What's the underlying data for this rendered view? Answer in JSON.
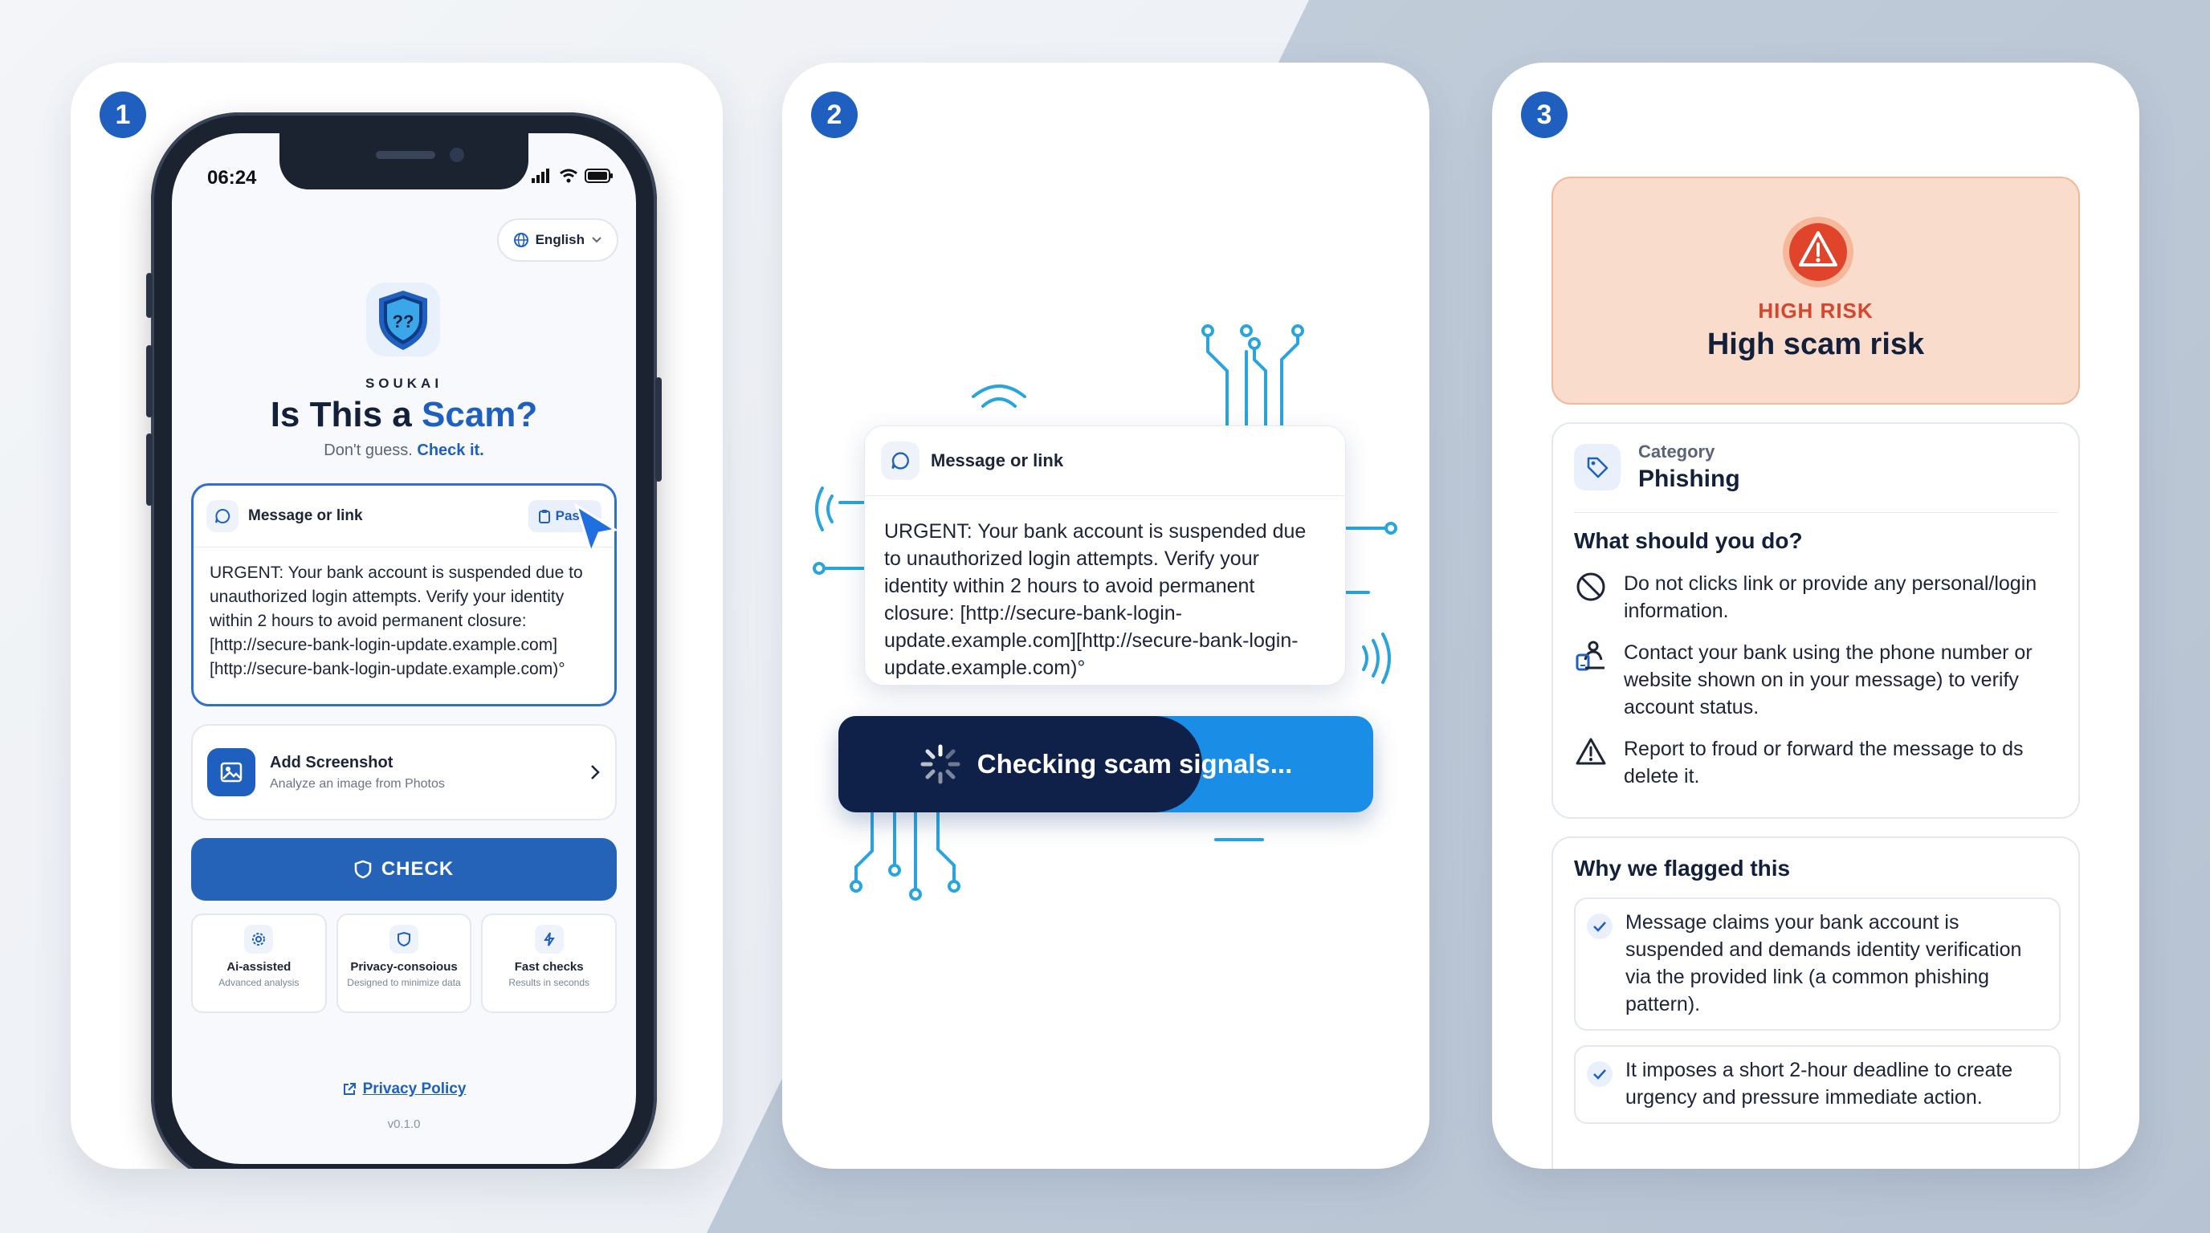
{
  "steps": [
    "1",
    "2",
    "3"
  ],
  "phone": {
    "status_time": "06:24",
    "language": "English",
    "brand": "SOUKAI",
    "title_prefix": "Is This a",
    "title_accent": "Scam?",
    "tagline_prefix": "Don't guess.",
    "tagline_accent": "Check it.",
    "message_label": "Message or link",
    "paste_label": "Paste",
    "message_text": "URGENT: Your bank account is suspended due to unauthorized login attempts. Verify your identity within 2 hours to avoid permanent closure: [http://secure-bank-login-update.example.com][http://secure-bank-login-update.example.com)°",
    "screenshot_title": "Add Screenshot",
    "screenshot_sub": "Analyze an image from Photos",
    "check_label": "CHECK",
    "features": [
      {
        "title": "Ai-assisted",
        "sub": "Advanced analysis",
        "icon": "gear-icon"
      },
      {
        "title": "Privacy-consoious",
        "sub": "Designed to minimize data",
        "icon": "shield-icon"
      },
      {
        "title": "Fast checks",
        "sub": "Results in seconds",
        "icon": "bolt-icon"
      }
    ],
    "privacy_link": "Privacy Policy",
    "version": "v0.1.0"
  },
  "analysis": {
    "message_label": "Message or link",
    "message_text": "URGENT: Your bank account is suspended due to unauthorized login attempts. Verify your identity within 2 hours to avoid permanent closure: [http://secure-bank-login-update.example.com][http://secure-bank-login-update.example.com)°",
    "progress_label": "Checking scam signals...",
    "progress_fraction": 0.68
  },
  "result": {
    "risk_level": "HIGH RISK",
    "risk_title": "High scam risk",
    "category_label": "Category",
    "category_value": "Phishing",
    "todo_title": "What should you do?",
    "todo_items": [
      {
        "icon": "block-icon",
        "text": "Do not clicks link or provide any personal/login information."
      },
      {
        "icon": "phone-support-icon",
        "text": "Contact your bank using the phone number or website shown on in your message) to verify account status."
      },
      {
        "icon": "warning-icon",
        "text": "Report to froud or forward the message to ds delete it."
      }
    ],
    "why_title": "Why we flagged this",
    "reasons": [
      "Message claims your bank account is suspended and demands identity verification via the provided link (a common phishing pattern).",
      "It imposes a short 2-hour deadline to create urgency and pressure immediate action."
    ]
  },
  "colors": {
    "primary": "#1f5fbf",
    "risk": "#d6452d",
    "risk_bg": "#fadccd",
    "progress_dark": "#0f2148",
    "progress_light": "#1a8de6",
    "circuit": "#2aa4dc"
  }
}
